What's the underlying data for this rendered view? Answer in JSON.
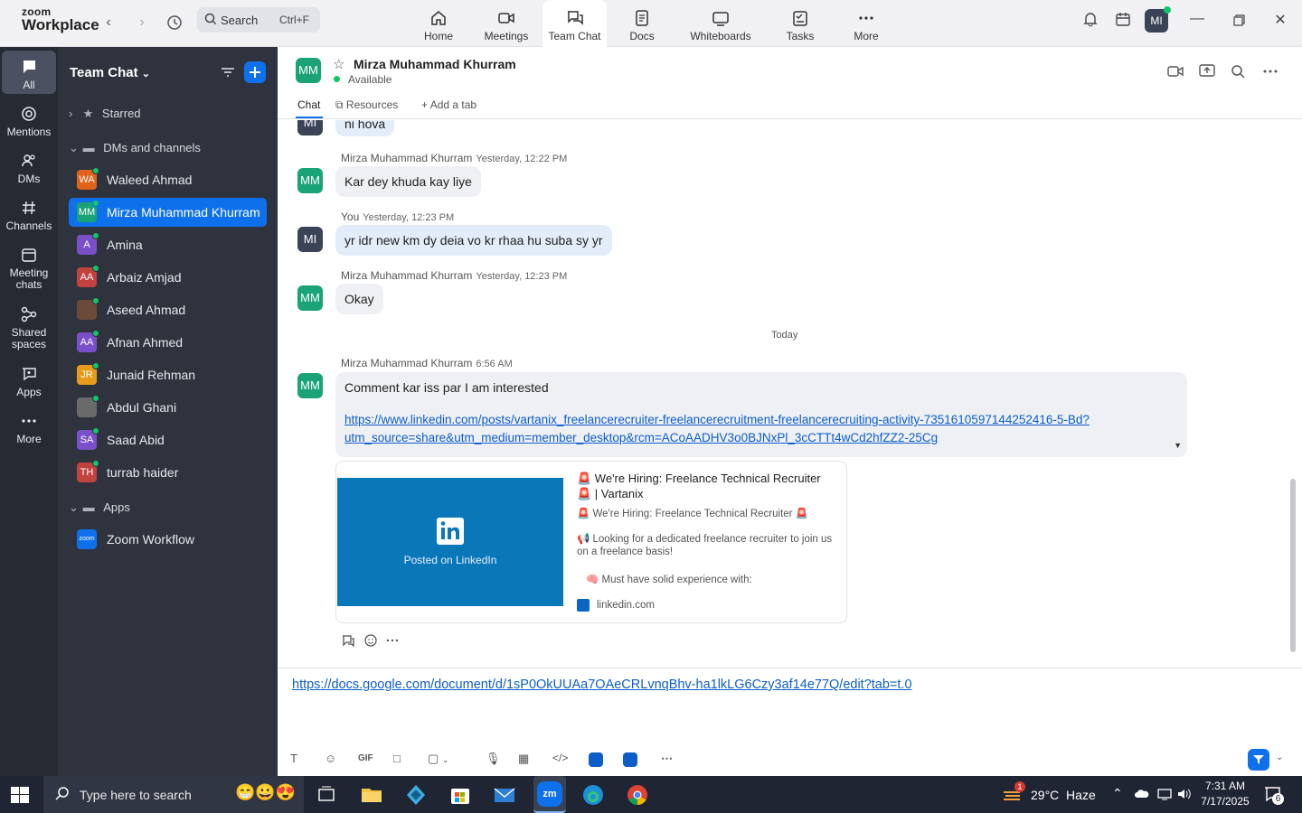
{
  "app": {
    "brand_small": "zoom",
    "brand_large": "Workplace"
  },
  "search": {
    "label": "Search",
    "shortcut": "Ctrl+F"
  },
  "nav_tabs": [
    {
      "label": "Home",
      "icon": "home-icon"
    },
    {
      "label": "Meetings",
      "icon": "camera-icon"
    },
    {
      "label": "Team Chat",
      "icon": "chat-icon",
      "active": true
    },
    {
      "label": "Docs",
      "icon": "doc-icon"
    },
    {
      "label": "Whiteboards",
      "icon": "whiteboard-icon"
    },
    {
      "label": "Tasks",
      "icon": "tasks-icon"
    },
    {
      "label": "More",
      "icon": "more-icon"
    }
  ],
  "profile": {
    "initials": "MI"
  },
  "rail": [
    {
      "label": "All",
      "icon": "chat-bubble-icon",
      "active": true
    },
    {
      "label": "Mentions",
      "icon": "at-icon"
    },
    {
      "label": "DMs",
      "icon": "people-icon"
    },
    {
      "label": "Channels",
      "icon": "hash-icon"
    },
    {
      "label": "Meeting chats",
      "icon": "calendar-icon"
    },
    {
      "label": "Shared spaces",
      "icon": "share-icon"
    },
    {
      "label": "Apps",
      "icon": "apps-icon"
    },
    {
      "label": "More",
      "icon": "more-icon"
    }
  ],
  "sidebar": {
    "title": "Team Chat",
    "sections": {
      "starred": "Starred",
      "dms": "DMs and channels",
      "apps": "Apps"
    },
    "contacts": [
      {
        "initials": "WA",
        "name": "Waleed Ahmad",
        "color": "#e0621b"
      },
      {
        "initials": "MM",
        "name": "Mirza Muhammad Khurram",
        "color": "#1aa377",
        "active": true
      },
      {
        "initials": "A",
        "name": "Amina",
        "color": "#7b4fc9"
      },
      {
        "initials": "AA",
        "name": "Arbaiz Amjad",
        "color": "#c2423f"
      },
      {
        "initials": "",
        "name": "Aseed Ahmad",
        "color": "#6b4a3a"
      },
      {
        "initials": "AA",
        "name": "Afnan Ahmed",
        "color": "#7b4fc9"
      },
      {
        "initials": "JR",
        "name": "Junaid Rehman",
        "color": "#e89a1b"
      },
      {
        "initials": "",
        "name": "Abdul Ghani",
        "color": "#6a6a6a"
      },
      {
        "initials": "SA",
        "name": "Saad Abid",
        "color": "#7b4fc9"
      },
      {
        "initials": "TH",
        "name": "turrab haider",
        "color": "#c2423f"
      }
    ],
    "apps": [
      {
        "initials": "zoom",
        "name": "Zoom Workflow",
        "color": "#0e71eb"
      }
    ]
  },
  "chat": {
    "contact_initials": "MM",
    "contact_name": "Mirza Muhammad Khurram",
    "status": "Available",
    "tabs": {
      "chat": "Chat",
      "resources": "Resources",
      "add": "Add a tab"
    },
    "messages": [
      {
        "avatar": "MI",
        "text": "ni hova"
      },
      {
        "sender": "Mirza Muhammad Khurram",
        "time": "Yesterday, 12:22 PM",
        "avatar": "MM",
        "text": "Kar dey khuda kay liye"
      },
      {
        "sender": "You",
        "time": "Yesterday, 12:23 PM",
        "avatar": "MI",
        "text": "yr idr new km dy deia vo kr rhaa hu suba sy yr"
      },
      {
        "sender": "Mirza Muhammad Khurram",
        "time": "Yesterday, 12:23 PM",
        "avatar": "MM",
        "text": "Okay"
      }
    ],
    "divider": "Today",
    "last_message": {
      "sender": "Mirza Muhammad Khurram",
      "time": "6:56 AM",
      "avatar": "MM",
      "text": "Comment kar iss par I am interested",
      "link_line1": "https://www.linkedin.com/posts/vartanix_freelancerecruiter-freelancerecruitment-freelancerecruiting-activity-7351610597144252416-5-Bd?",
      "link_line2": "utm_source=share&utm_medium=member_desktop&rcm=ACoAADHV3o0BJNxPl_3cCTTt4wCd2hfZZ2-25Cg"
    },
    "preview": {
      "image_caption": "Posted on LinkedIn",
      "title": "🚨 We're Hiring: Freelance Technical Recruiter 🚨 | Vartanix",
      "line1": "🚨 We're Hiring: Freelance Technical Recruiter 🚨",
      "line2": "📢 Looking for a dedicated freelance recruiter to join us on a freelance basis!",
      "line3": "🧠 Must have solid experience with:",
      "domain": "linkedin.com"
    },
    "composer_text": "https://docs.google.com/document/d/1sP0OkUUAa7OAeCRLvnqBhv-ha1lkLG6Czy3af14e77Q/edit?tab=t.0"
  },
  "taskbar": {
    "search_placeholder": "Type here to search",
    "weather": "29°C  Haze",
    "time": "7:31 AM",
    "date": "7/17/2025",
    "notification_count": "6",
    "weather_badge": "1"
  }
}
